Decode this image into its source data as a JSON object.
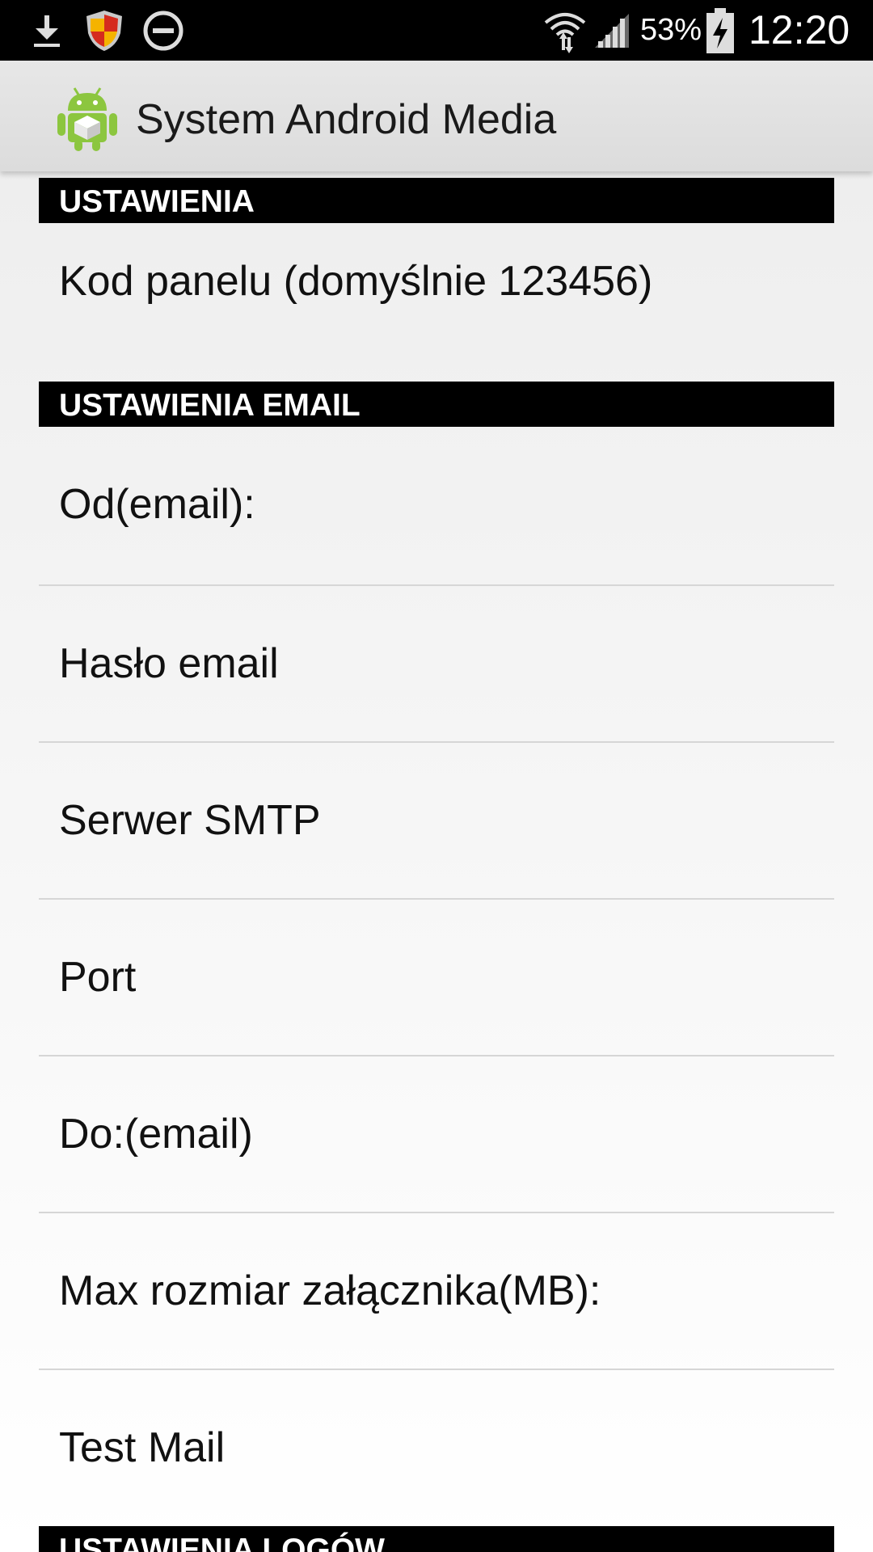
{
  "status_bar": {
    "battery_percent": "53%",
    "time": "12:20",
    "icons": [
      "download-icon",
      "security-shield-icon",
      "do-not-disturb-icon",
      "wifi-icon",
      "signal-icon",
      "battery-charging-icon"
    ]
  },
  "action_bar": {
    "app_icon": "android-robot-icon",
    "title": "System Android Media"
  },
  "sections": {
    "settings_header": "USTAWIENIA",
    "panel_code": "Kod panelu (domyślnie 123456)",
    "email_header": "USTAWIENIA EMAIL",
    "email_items": [
      "Od(email):",
      "Hasło email",
      "Serwer SMTP",
      "Port",
      "Do:(email)",
      "Max rozmiar załącznika(MB):",
      "Test Mail"
    ],
    "logs_header": "USTAWIENIA LOGÓW"
  },
  "colors": {
    "section_header_bg": "#000000",
    "action_bar_bg": "#e2e2e2",
    "divider": "#d6d6d6"
  }
}
